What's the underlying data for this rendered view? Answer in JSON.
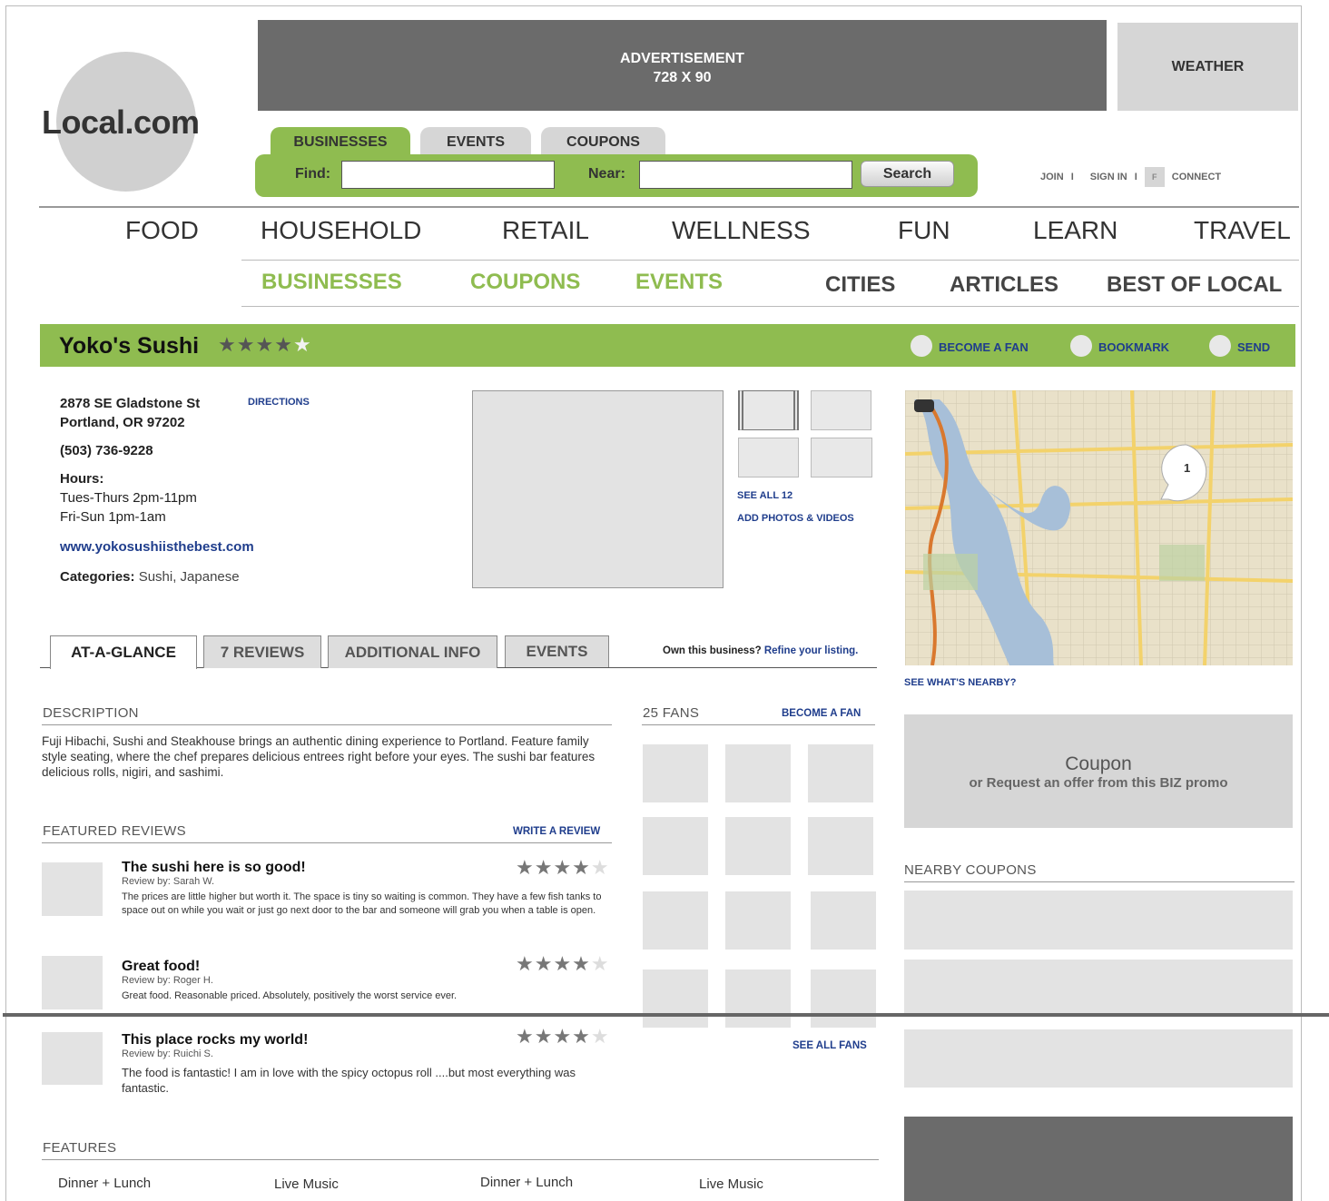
{
  "ad": {
    "title": "ADVERTISEMENT",
    "size": "728 X 90"
  },
  "weather": "WEATHER",
  "logo": "Local.com",
  "search": {
    "tabs": [
      "BUSINESSES",
      "EVENTS",
      "COUPONS"
    ],
    "find_label": "Find:",
    "near_label": "Near:",
    "find_value": "",
    "near_value": "",
    "button": "Search"
  },
  "account": {
    "join": "JOIN",
    "signin": "SIGN IN",
    "fb": "F",
    "connect": "CONNECT",
    "sep": "I"
  },
  "categories": [
    "FOOD",
    "HOUSEHOLD",
    "RETAIL",
    "WELLNESS",
    "FUN",
    "LEARN",
    "TRAVEL"
  ],
  "subnav": [
    "BUSINESSES",
    "COUPONS",
    "EVENTS",
    "CITIES",
    "ARTICLES",
    "BEST OF LOCAL"
  ],
  "business": {
    "name": "Yoko's Sushi",
    "rating": 4,
    "actions": [
      "BECOME A FAN",
      "BOOKMARK",
      "SEND"
    ],
    "address1": "2878 SE Gladstone St",
    "address2": "Portland, OR 97202",
    "directions": "DIRECTIONS",
    "phone": "(503) 736-9228",
    "hours_label": "Hours:",
    "hours1": "Tues-Thurs  2pm-11pm",
    "hours2": "Fri-Sun 1pm-1am",
    "website": "www.yokosushiisthebest.com",
    "categories_label": "Categories:",
    "categories_value": " Sushi, Japanese"
  },
  "media": {
    "see_all": "SEE ALL 12",
    "add": "ADD PHOTOS & VIDEOS"
  },
  "map": {
    "pin": "1",
    "nearby": "SEE WHAT'S NEARBY?"
  },
  "tabs": [
    "AT-A-GLANCE",
    "7 REVIEWS",
    "ADDITIONAL INFO",
    "EVENTS"
  ],
  "own": {
    "text": "Own this business? ",
    "link": "Refine your listing."
  },
  "description": {
    "header": "DESCRIPTION",
    "body": "Fuji Hibachi, Sushi and Steakhouse brings an authentic dining experience to Portland. Feature family style seating, where the chef prepares delicious entrees right before your eyes. The sushi bar features delicious rolls, nigiri, and sashimi."
  },
  "fans": {
    "header": "25 FANS",
    "become": "BECOME A FAN",
    "see_all": "SEE ALL FANS"
  },
  "reviews": {
    "header": "FEATURED REVIEWS",
    "write": "WRITE A REVIEW",
    "items": [
      {
        "title": "The sushi here is so good!",
        "by": "Review by: Sarah W.",
        "rating": 4,
        "body": "The prices are little higher but worth it. The space is tiny so waiting is common.  They have a few fish tanks to space out on while you wait or just go next door to the bar and someone will grab you when a table is open."
      },
      {
        "title": "Great food!",
        "by": "Review by: Roger H.",
        "rating": 4,
        "body": "Great food. Reasonable priced. Absolutely, positively the worst service ever."
      },
      {
        "title": "This place rocks my world!",
        "by": "Review by: Ruichi S.",
        "rating": 4,
        "body": "The food is fantastic! I am in love with the spicy octopus roll ....but most everything was fantastic."
      }
    ]
  },
  "coupon": {
    "title": "Coupon",
    "sub": "or  Request an offer from this BIZ promo"
  },
  "nearby_coupons": "NEARBY COUPONS",
  "features": {
    "header": "FEATURES",
    "items": [
      "Dinner + Lunch",
      "Live Music",
      "Dinner + Lunch",
      "Live Music"
    ]
  },
  "colors": {
    "accent_green": "#8fbc50",
    "link_blue": "#1f3d8c",
    "ad_gray": "#6b6b6b"
  }
}
